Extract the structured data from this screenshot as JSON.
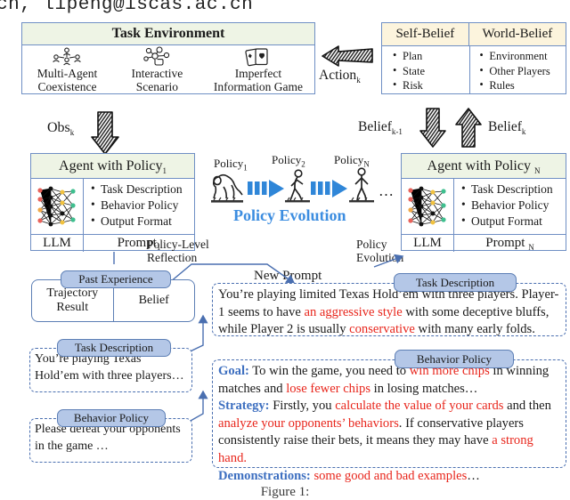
{
  "header": {
    "email_fragment": "cn, lipeng@iscas.ac.cn"
  },
  "task_environment": {
    "title": "Task Environment",
    "items": [
      {
        "icon": "multi-agent-icon",
        "line1": "Multi-Agent",
        "line2": "Coexistence"
      },
      {
        "icon": "interactive-scenario-icon",
        "line1": "Interactive",
        "line2": "Scenario"
      },
      {
        "icon": "cards-icon",
        "line1": "Imperfect",
        "line2": "Information Game"
      }
    ]
  },
  "belief_table": {
    "columns": [
      "Self-Belief",
      "World-Belief"
    ],
    "self_belief_items": [
      "Plan",
      "State",
      "Risk"
    ],
    "world_belief_items": [
      "Environment",
      "Other Players",
      "Rules"
    ]
  },
  "arrow_labels": {
    "obs": "Obs",
    "obs_sub": "k",
    "action": "Action",
    "action_sub": "k",
    "belief_prev": "Belief",
    "belief_prev_sub": "k-1",
    "belief_cur": "Belief",
    "belief_cur_sub": "k"
  },
  "agent_left": {
    "title": "Agent with Policy",
    "title_sub": "1",
    "bullets": [
      "Task Description",
      "Behavior Policy",
      "Output Format"
    ],
    "footer_left": "LLM",
    "footer_right": "Prompt",
    "footer_right_sub": "1"
  },
  "agent_right": {
    "title": "Agent with Policy",
    "title_sub": "N",
    "bullets": [
      "Task Description",
      "Behavior Policy",
      "Output Format"
    ],
    "footer_left": "LLM",
    "footer_right": "Prompt",
    "footer_right_sub": "N"
  },
  "policy_evolution": {
    "label": "Policy Evolution",
    "stage_labels": [
      {
        "text": "Policy",
        "sub": "1"
      },
      {
        "text": "Policy",
        "sub": "2"
      },
      {
        "text": "Policy",
        "sub": "N"
      }
    ],
    "ellipsis": "…",
    "accent_color": "#3c8de0"
  },
  "connector_labels": {
    "policy_level_reflection_line1": "Policy-Level",
    "policy_level_reflection_line2": "Reflection",
    "new_prompt": "New Prompt",
    "policy_evolution_line1": "Policy",
    "policy_evolution_line2": "Evolution"
  },
  "past_experience": {
    "tag": "Past Experience",
    "cells": [
      {
        "line1": "Trajectory",
        "line2": "Result"
      },
      {
        "line1": "Belief",
        "line2": ""
      }
    ]
  },
  "task_description_small": {
    "tag": "Task Description",
    "line1": "You’re playing Texas",
    "line2": "Hold’em with three players…"
  },
  "behavior_policy_small": {
    "tag": "Behavior Policy",
    "line1": "Please defeat your opponents",
    "line2": "in the game …"
  },
  "task_description_big": {
    "tag": "Task Description",
    "segments": [
      {
        "t": "You’re playing limited Texas Hold’em with three players. Player-1 seems to have ",
        "c": "black"
      },
      {
        "t": "an aggressive style",
        "c": "red"
      },
      {
        "t": " with some deceptive bluffs, while Player 2 is usually ",
        "c": "black"
      },
      {
        "t": "conservative",
        "c": "red"
      },
      {
        "t": " with many early folds.",
        "c": "black"
      }
    ]
  },
  "behavior_policy_big": {
    "tag": "Behavior Policy",
    "lines": [
      [
        {
          "t": "Goal:",
          "c": "blue"
        },
        {
          "t": " To win the game, you need to ",
          "c": "black"
        },
        {
          "t": "win more chips",
          "c": "red"
        },
        {
          "t": " in winning matches and ",
          "c": "black"
        },
        {
          "t": "lose fewer chips",
          "c": "red"
        },
        {
          "t": " in losing matches…",
          "c": "black"
        }
      ],
      [
        {
          "t": "Strategy:",
          "c": "blue"
        },
        {
          "t": " Firstly, you ",
          "c": "black"
        },
        {
          "t": "calculate the value of your cards",
          "c": "red"
        },
        {
          "t": " and then ",
          "c": "black"
        },
        {
          "t": "analyze your opponents’ behaviors",
          "c": "red"
        },
        {
          "t": ". If conservative players consistently raise their bets, it means they may have ",
          "c": "black"
        },
        {
          "t": "a strong hand.",
          "c": "red"
        }
      ],
      [
        {
          "t": "Demonstrations:",
          "c": "blue"
        },
        {
          "t": " ",
          "c": "black"
        },
        {
          "t": "some good and bad examples",
          "c": "red"
        },
        {
          "t": "…",
          "c": "black"
        }
      ]
    ]
  },
  "figure_caption": {
    "text": "Figure 1:"
  }
}
